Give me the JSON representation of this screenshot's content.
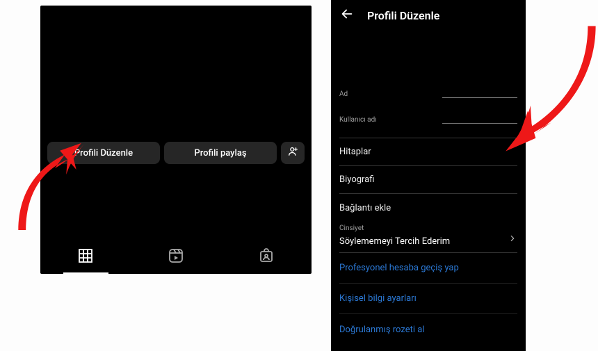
{
  "left": {
    "edit_btn": "Profili Düzenle",
    "share_btn": "Profili paylaş"
  },
  "right": {
    "title": "Profili Düzenle",
    "name_label": "Ad",
    "username_label": "Kullanıcı adı",
    "pronouns_label": "Hitaplar",
    "bio_label": "Biyografi",
    "add_link_label": "Bağlantı ekle",
    "gender_label": "Cinsiyet",
    "gender_value": "Söylememeyi Tercih Ederim",
    "link_switch_pro": "Profesyonel hesaba geçiş yap",
    "link_personal_info": "Kişisel bilgi ayarları",
    "link_verified_badge": "Doğrulanmış rozeti al"
  }
}
